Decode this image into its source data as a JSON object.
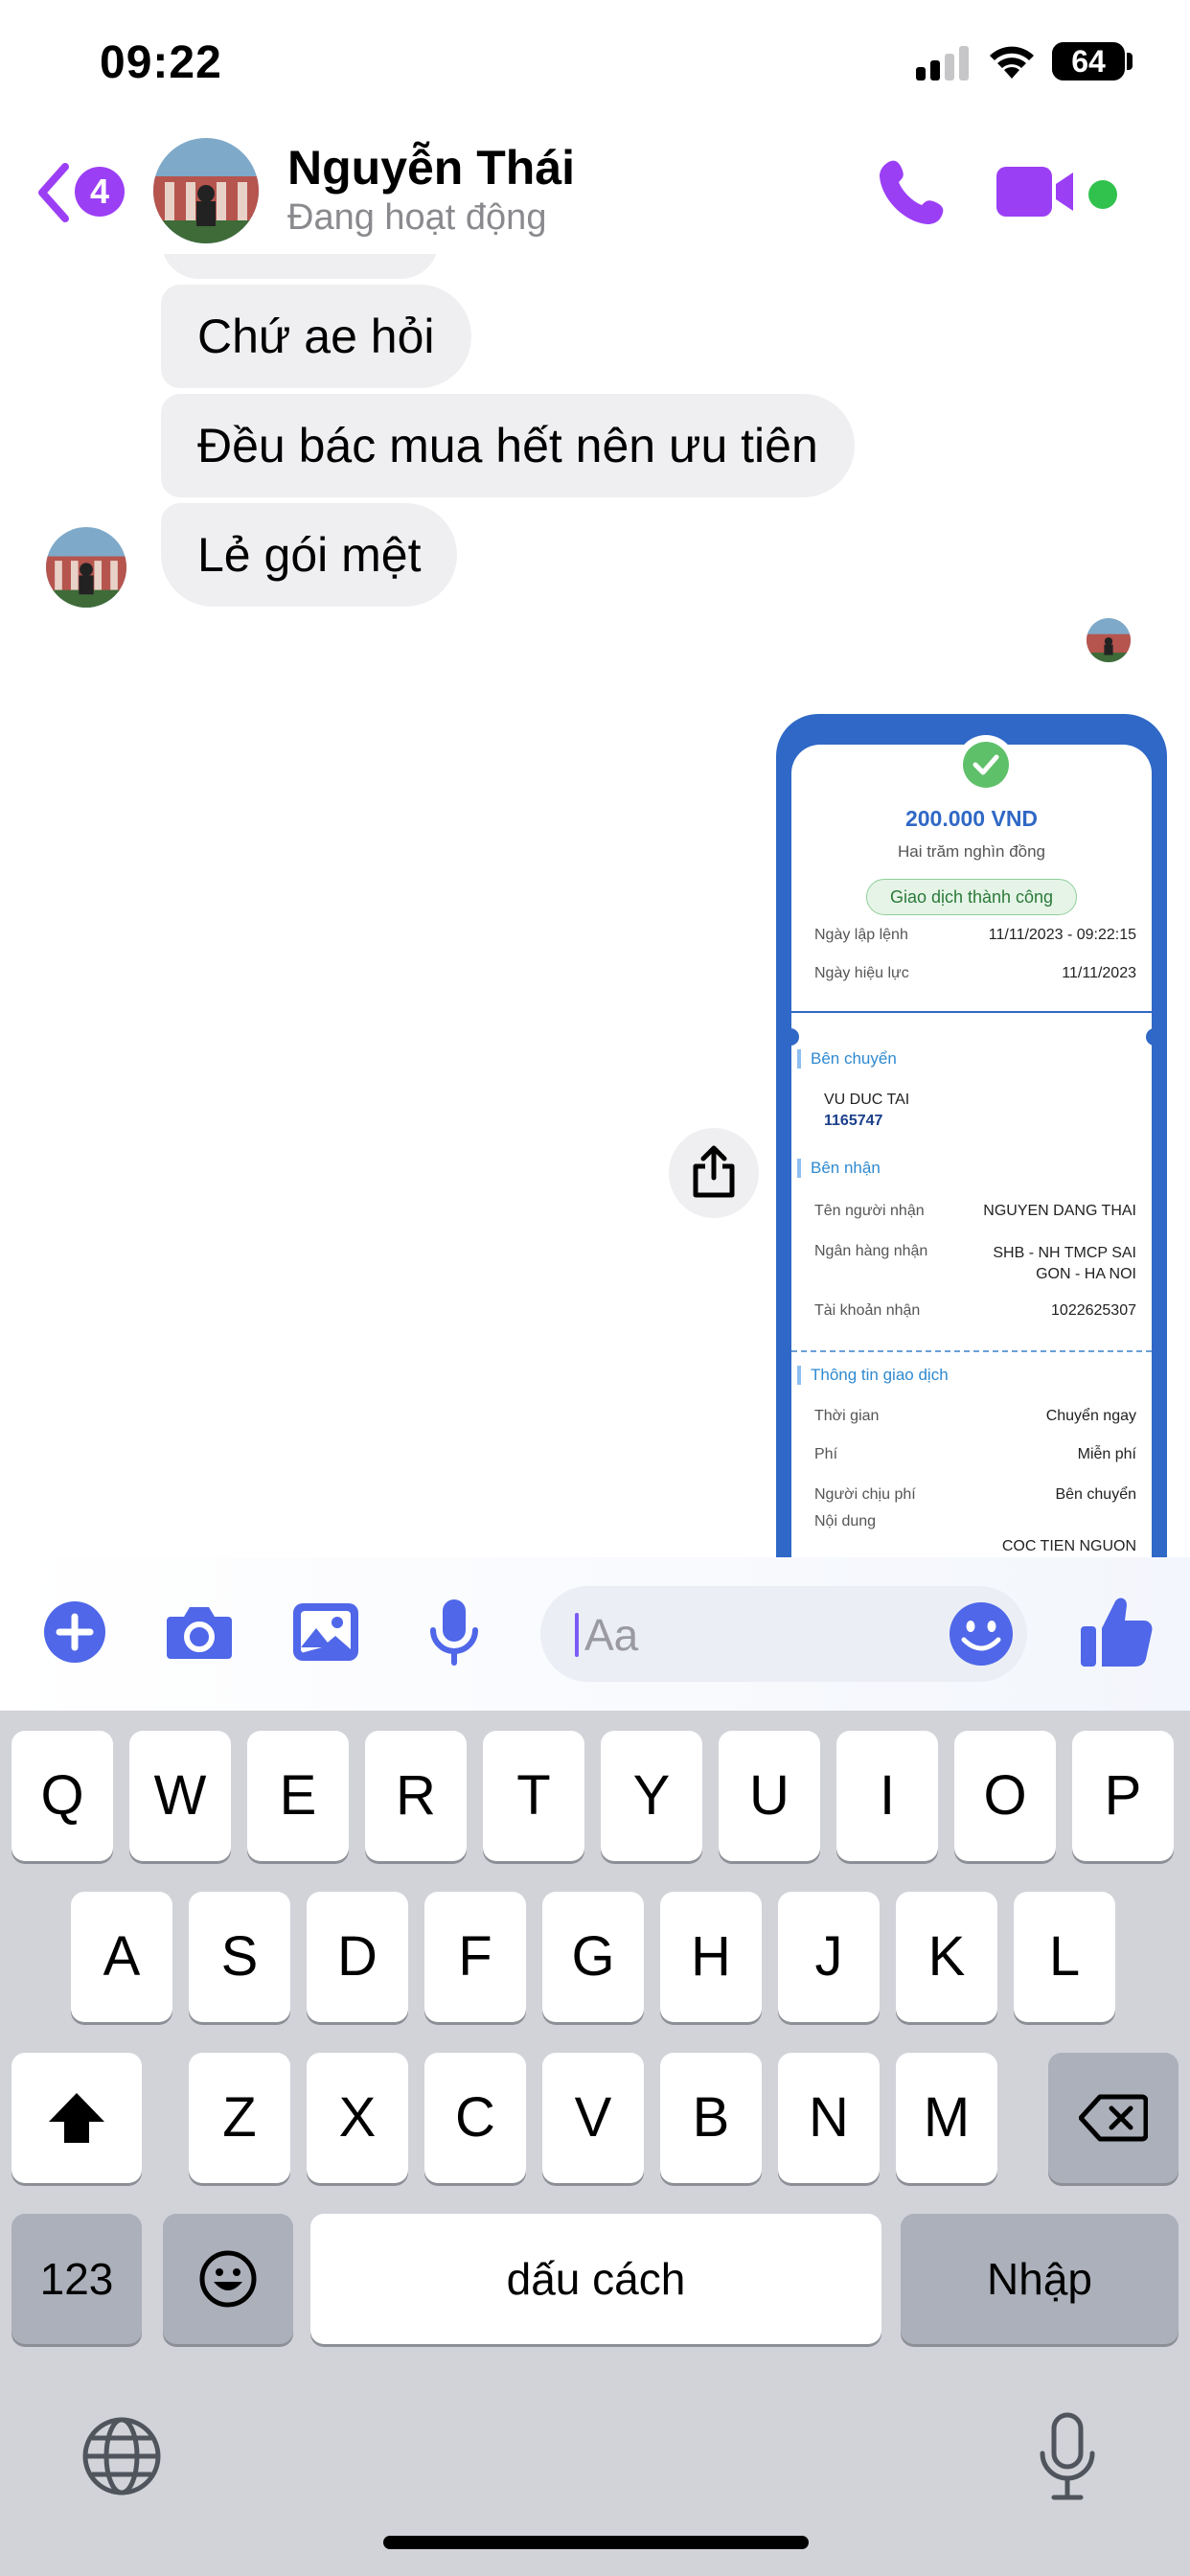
{
  "status_bar": {
    "time": "09:22",
    "battery": "64"
  },
  "header": {
    "back_badge": "4",
    "contact_name": "Nguyễn Thái",
    "contact_status": "Đang hoạt động",
    "icons": [
      "chevron-left-icon",
      "phone-icon",
      "video-camera-icon"
    ],
    "accent_color": "#9b3ff5",
    "online_color": "#31c24d"
  },
  "messages": [
    {
      "text": "Chứ ae hỏi"
    },
    {
      "text": "Đều bác mua hết nên ưu tiên"
    },
    {
      "text": "Lẻ gói mệt"
    }
  ],
  "receipt": {
    "amount": "200.000 VND",
    "amount_words": "Hai trăm nghìn đồng",
    "status": "Giao dịch thành công",
    "order_date_label": "Ngày lập lệnh",
    "order_date": "11/11/2023 - 09:22:15",
    "effective_date_label": "Ngày hiệu lực",
    "effective_date": "11/11/2023",
    "sender_section": "Bên chuyển",
    "sender_name": "VU DUC TAI",
    "sender_account": "1165747",
    "receiver_section": "Bên nhận",
    "receiver_name_label": "Tên người nhận",
    "receiver_name": "NGUYEN DANG THAI",
    "receiver_bank_label": "Ngân hàng nhận",
    "receiver_bank_line1": "SHB - NH TMCP SAI",
    "receiver_bank_line2": "GON - HA NOI",
    "receiver_account_label": "Tài khoản nhận",
    "receiver_account": "1022625307",
    "transaction_section": "Thông tin giao dịch",
    "time_label": "Thời gian",
    "time_value": "Chuyển ngay",
    "fee_label": "Phí",
    "fee_value": "Miễn phí",
    "fee_payer_label": "Người chịu phí",
    "fee_payer_value": "Bên chuyển",
    "content_label": "Nội dung",
    "content_value": "COC TIEN NGUON"
  },
  "composer": {
    "placeholder": "Aa",
    "icons": [
      "plus-icon",
      "camera-icon",
      "image-icon",
      "microphone-icon",
      "emoji-icon",
      "thumbs-up-icon"
    ],
    "icon_color": "#4f67e8"
  },
  "keyboard": {
    "row1": [
      "Q",
      "W",
      "E",
      "R",
      "T",
      "Y",
      "U",
      "I",
      "O",
      "P"
    ],
    "row2": [
      "A",
      "S",
      "D",
      "F",
      "G",
      "H",
      "J",
      "K",
      "L"
    ],
    "row3": [
      "Z",
      "X",
      "C",
      "V",
      "B",
      "N",
      "M"
    ],
    "numbers_key": "123",
    "space_key": "dấu cách",
    "return_key": "Nhập"
  }
}
